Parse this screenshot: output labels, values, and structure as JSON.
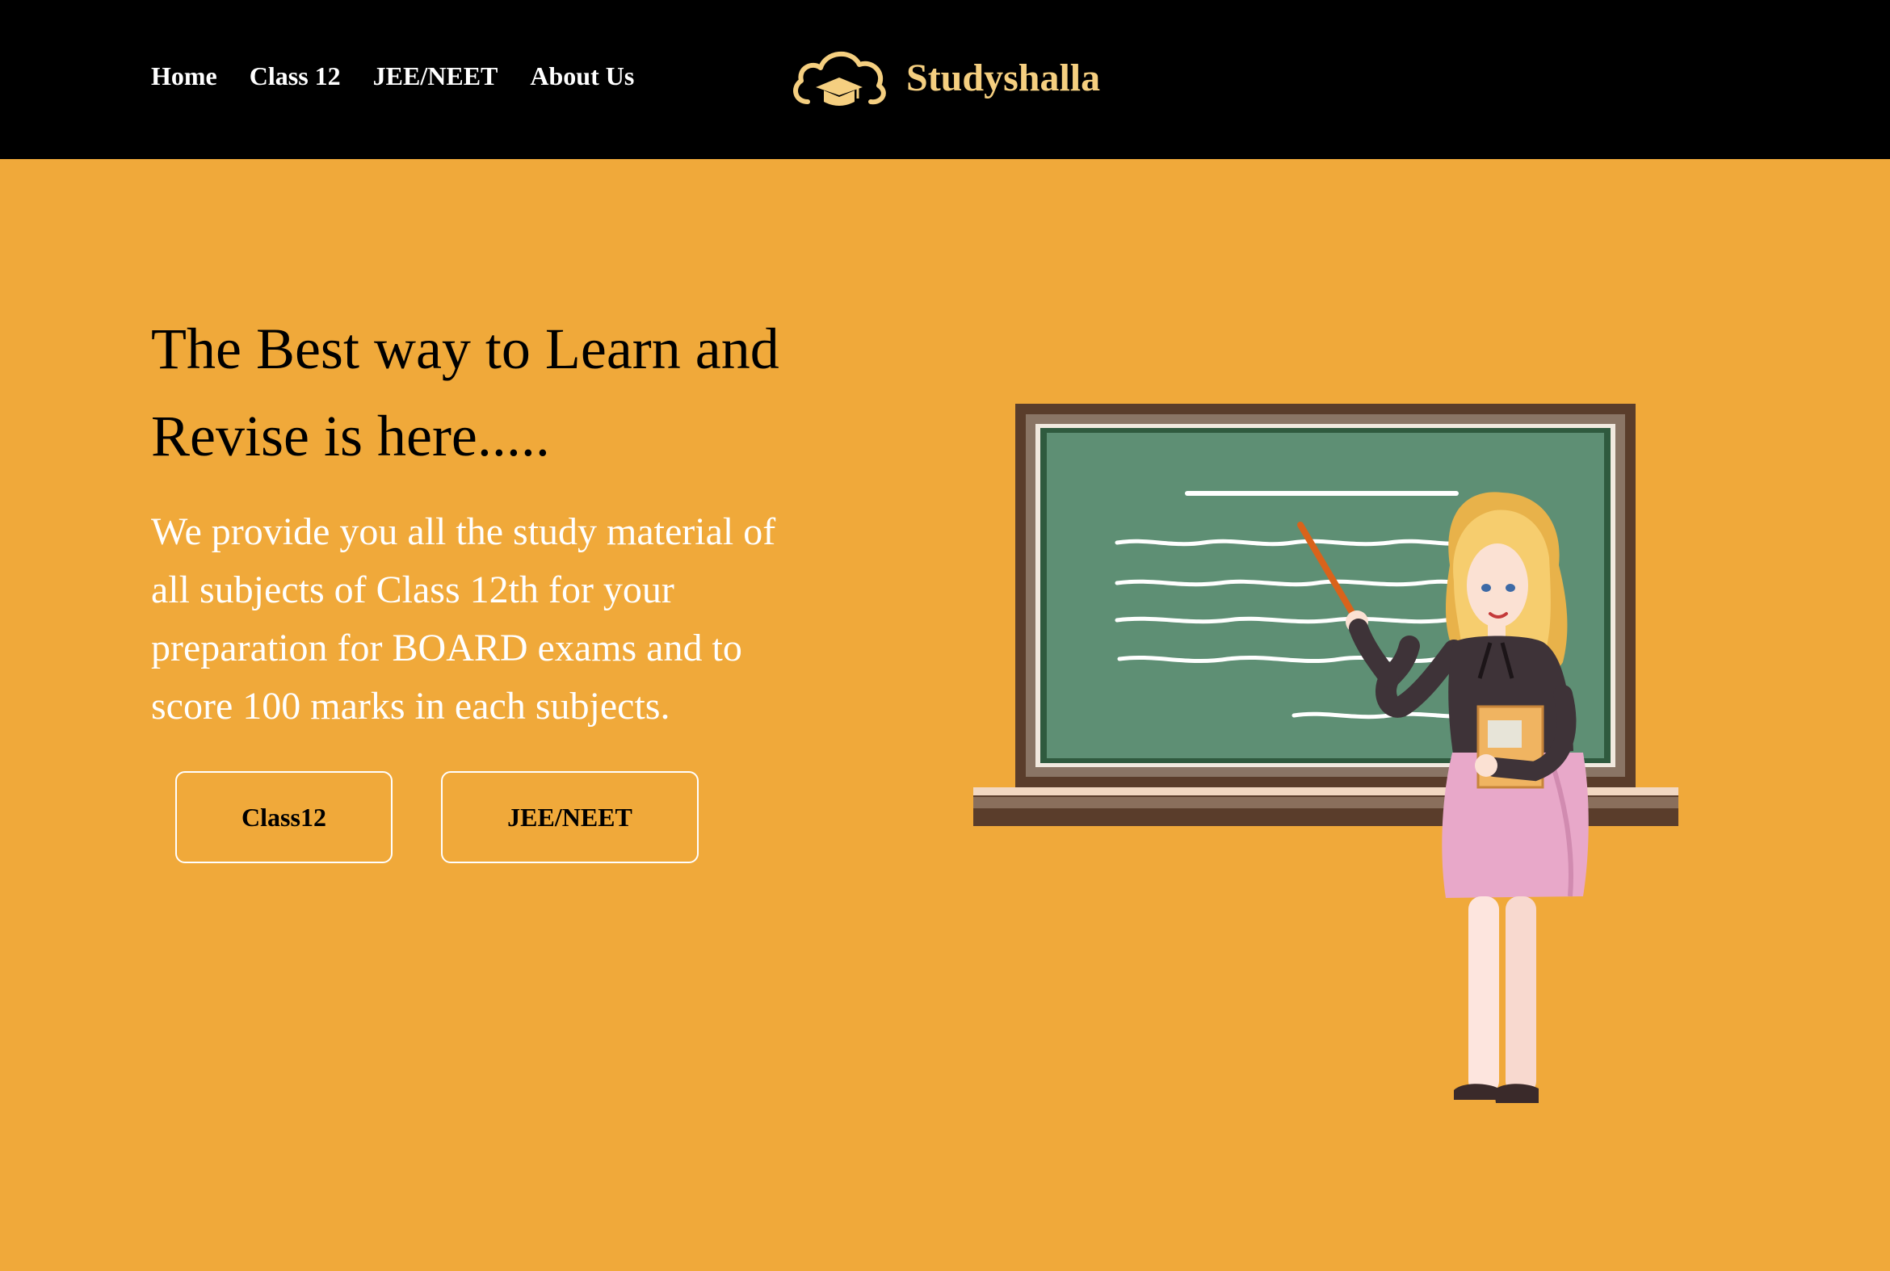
{
  "nav": {
    "links": [
      "Home",
      "Class 12",
      "JEE/NEET",
      "About Us"
    ]
  },
  "brand": {
    "name": "Studyshalla",
    "logo_icon": "cloud-graduation-cap-icon",
    "color": "#f5cf80"
  },
  "hero": {
    "title": "The Best way to Learn and Revise is here.....",
    "description": "We provide you all the study material of all subjects of Class 12th for your preparation for BOARD exams and to score 100 marks in each subjects.",
    "buttons": {
      "class12": "Class12",
      "jee": "JEE/NEET"
    },
    "background": "#f0a93a",
    "illustration": "teacher-at-chalkboard"
  }
}
